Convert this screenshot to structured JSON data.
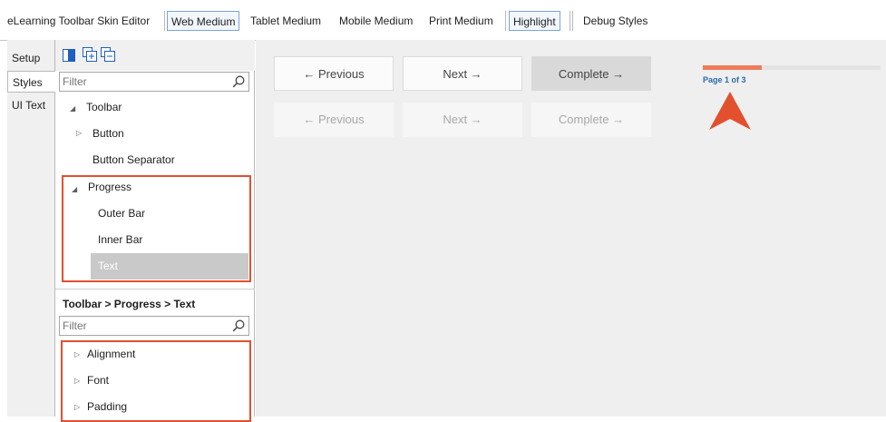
{
  "toolbar": {
    "title": "eLearning Toolbar Skin Editor",
    "items": [
      {
        "label": "Web Medium"
      },
      {
        "label": "Tablet Medium"
      },
      {
        "label": "Mobile Medium"
      },
      {
        "label": "Print Medium"
      },
      {
        "label": "Highlight"
      },
      {
        "label": "Debug Styles"
      }
    ]
  },
  "side_tabs": [
    {
      "label": "Setup"
    },
    {
      "label": "Styles"
    },
    {
      "label": "UI Text"
    }
  ],
  "active_side_tab": "Styles",
  "panel": {
    "filter_placeholder": "Filter",
    "tree": [
      {
        "label": "Toolbar",
        "expanded": true
      },
      {
        "label": "Button",
        "expanded": false
      },
      {
        "label": "Button Separator"
      },
      {
        "label": "Progress",
        "expanded": true
      },
      {
        "label": "Outer Bar"
      },
      {
        "label": "Inner Bar"
      },
      {
        "label": "Text",
        "selected": true
      }
    ],
    "breadcrumb": "Toolbar > Progress > Text",
    "props_filter_placeholder": "Filter",
    "properties": [
      {
        "label": "Alignment"
      },
      {
        "label": "Font"
      },
      {
        "label": "Padding"
      }
    ]
  },
  "preview": {
    "row1": [
      {
        "label": "← Previous",
        "state": "enabled"
      },
      {
        "label": "Next →",
        "state": "enabled"
      },
      {
        "label": "Complete →",
        "state": "highlight"
      }
    ],
    "row2": [
      {
        "label": "← Previous",
        "state": "disabled"
      },
      {
        "label": "Next →",
        "state": "disabled"
      },
      {
        "label": "Complete →",
        "state": "disabled"
      }
    ],
    "progress_text": "Page 1 of 3",
    "progress_fraction": 0.333,
    "colors": {
      "progress_fill": "#ee7b5a",
      "progress_track": "#e3e3e3",
      "progress_text": "#2d6aa8",
      "callout": "#e2502e"
    }
  }
}
